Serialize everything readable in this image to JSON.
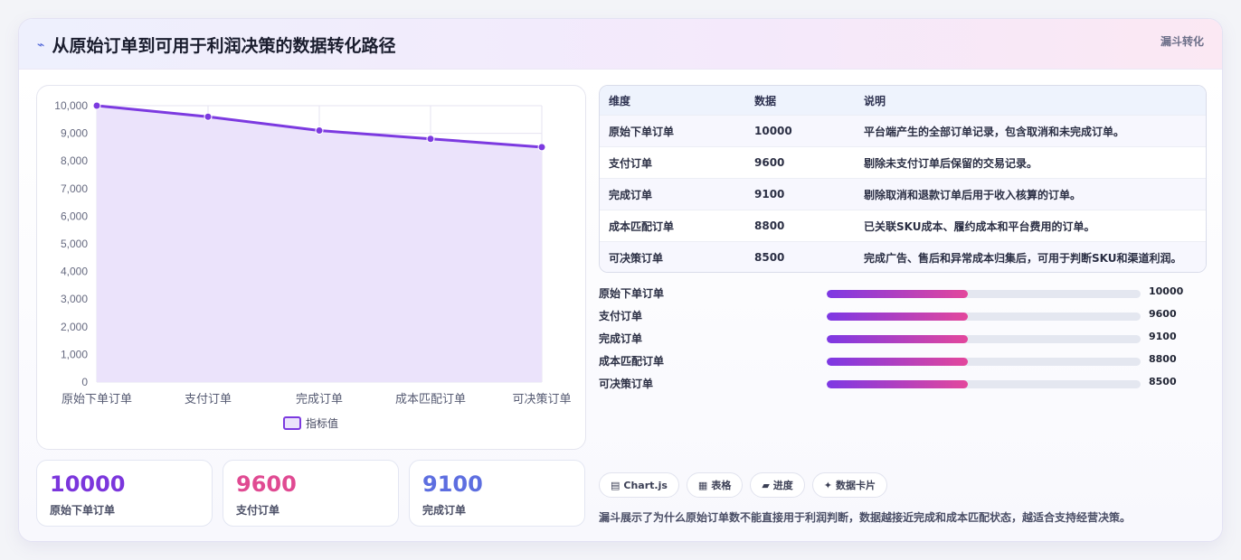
{
  "header": {
    "title": "从原始订单到可用于利润决策的数据转化路径",
    "tag": "漏斗转化",
    "icon": "sparkle-icon"
  },
  "chart_data": {
    "type": "line",
    "categories": [
      "原始下单订单",
      "支付订单",
      "完成订单",
      "成本匹配订单",
      "可决策订单"
    ],
    "series": [
      {
        "name": "指标值",
        "values": [
          10000,
          9600,
          9100,
          8800,
          8500
        ],
        "color": "#7c3ae0",
        "fill": "#ebe3fb"
      }
    ],
    "ylim": [
      0,
      10000
    ],
    "yticks": [
      "0",
      "1,000",
      "2,000",
      "3,000",
      "4,000",
      "5,000",
      "6,000",
      "7,000",
      "8,000",
      "9,000",
      "10,000"
    ],
    "legend": "bottom",
    "grid": true
  },
  "kpis": [
    {
      "value": "10000",
      "label": "原始下单订单",
      "color": "#7b36dc"
    },
    {
      "value": "9600",
      "label": "支付订单",
      "color": "#e04a92"
    },
    {
      "value": "9100",
      "label": "完成订单",
      "color": "#5d6ee0"
    }
  ],
  "table": {
    "headers": [
      "维度",
      "数据",
      "说明"
    ],
    "rows": [
      [
        "原始下单订单",
        "10000",
        "平台端产生的全部订单记录，包含取消和未完成订单。"
      ],
      [
        "支付订单",
        "9600",
        "剔除未支付订单后保留的交易记录。"
      ],
      [
        "完成订单",
        "9100",
        "剔除取消和退款订单后用于收入核算的订单。"
      ],
      [
        "成本匹配订单",
        "8800",
        "已关联SKU成本、履约成本和平台费用的订单。"
      ],
      [
        "可决策订单",
        "8500",
        "完成广告、售后和异常成本归集后，可用于判断SKU和渠道利润。"
      ]
    ]
  },
  "bars": [
    {
      "label": "原始下单订单",
      "value": "10000",
      "fill": 0.45
    },
    {
      "label": "支付订单",
      "value": "9600",
      "fill": 0.45
    },
    {
      "label": "完成订单",
      "value": "9100",
      "fill": 0.45
    },
    {
      "label": "成本匹配订单",
      "value": "8800",
      "fill": 0.45
    },
    {
      "label": "可决策订单",
      "value": "8500",
      "fill": 0.45
    }
  ],
  "chips": [
    {
      "icon": "chart-icon",
      "glyph": "▤",
      "label": "Chart.js"
    },
    {
      "icon": "table-icon",
      "glyph": "▦",
      "label": "表格"
    },
    {
      "icon": "progress-icon",
      "glyph": "▰",
      "label": "进度"
    },
    {
      "icon": "card-icon",
      "glyph": "✦",
      "label": "数据卡片"
    }
  ],
  "note": "漏斗展示了为什么原始订单数不能直接用于利润判断，数据越接近完成和成本匹配状态，越适合支持经营决策。"
}
